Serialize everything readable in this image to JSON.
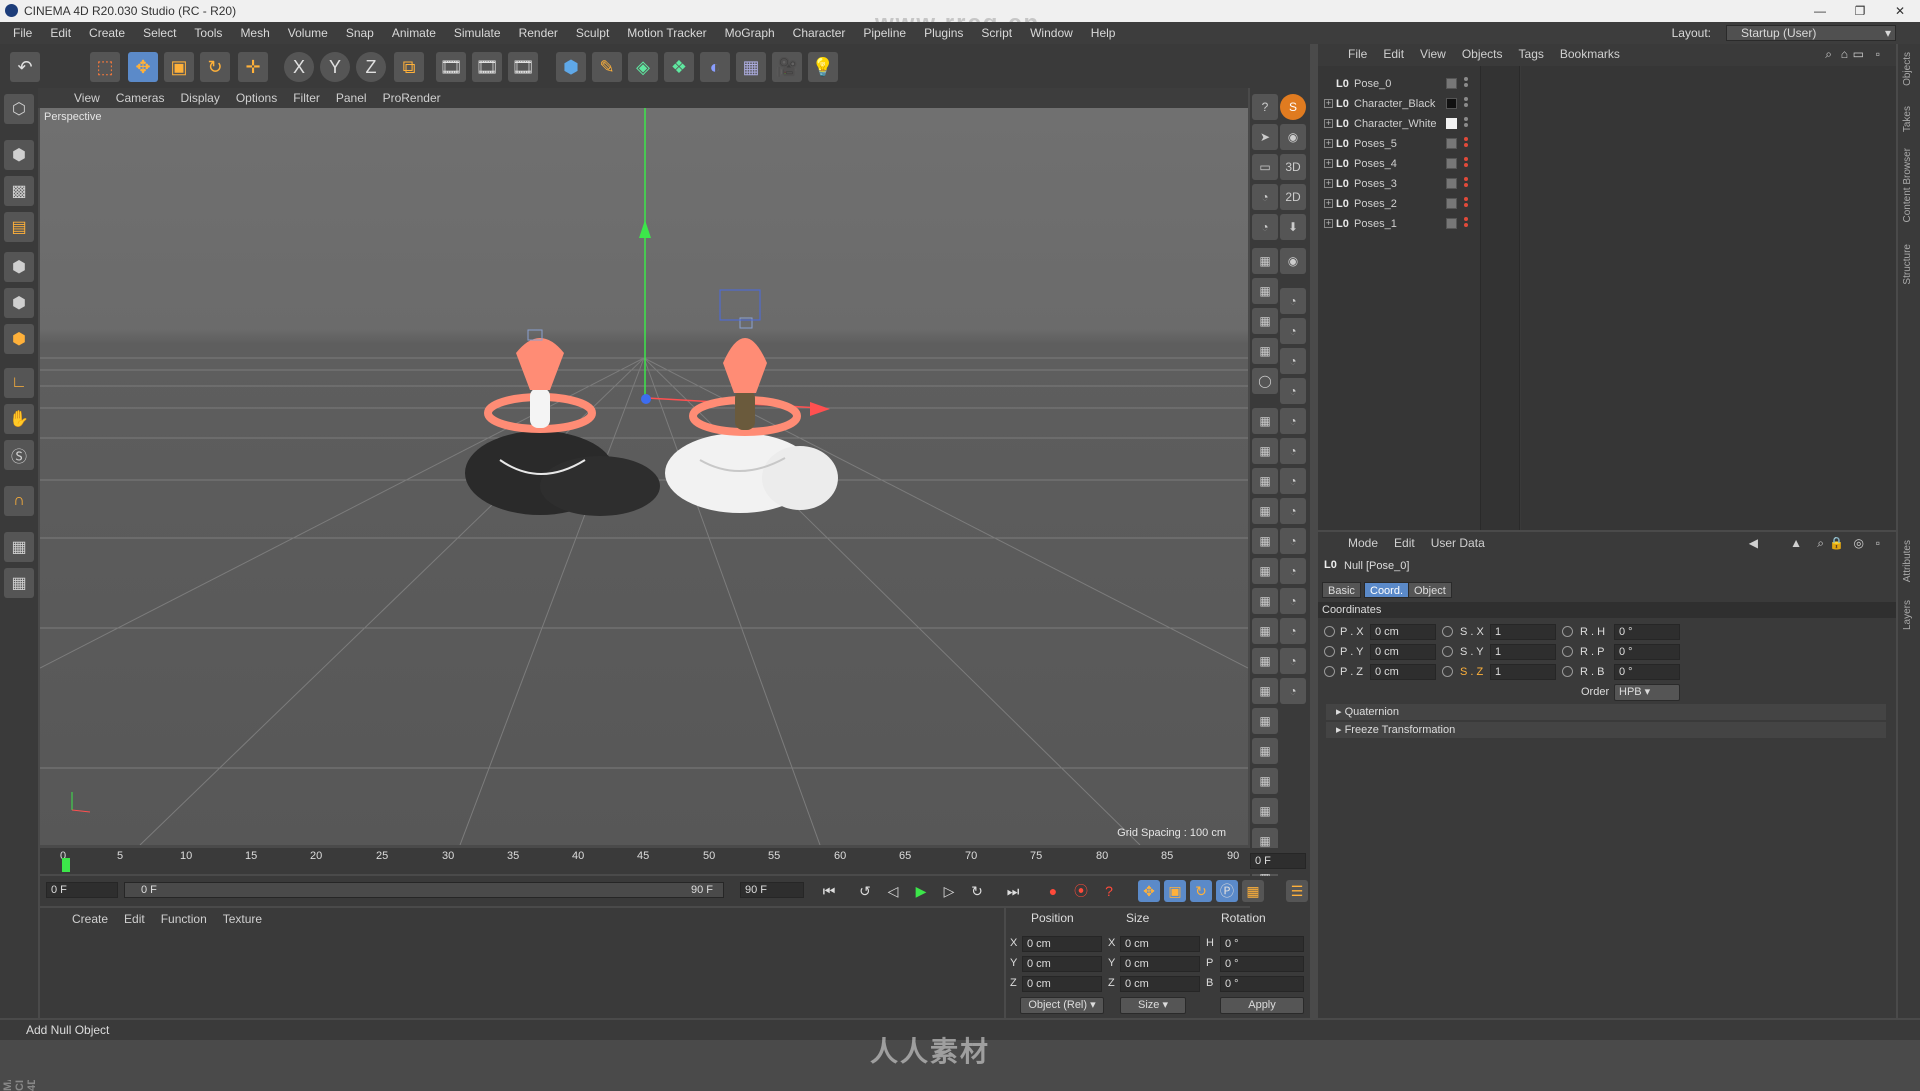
{
  "window": {
    "title": "CINEMA 4D R20.030 Studio (RC - R20)"
  },
  "menubar": {
    "items": [
      "File",
      "Edit",
      "Create",
      "Select",
      "Tools",
      "Mesh",
      "Volume",
      "Snap",
      "Animate",
      "Simulate",
      "Render",
      "Sculpt",
      "Motion Tracker",
      "MoGraph",
      "Character",
      "Pipeline",
      "Plugins",
      "Script",
      "Window",
      "Help"
    ],
    "layout_label": "Layout:",
    "layout_value": "Startup (User)"
  },
  "toolbar": {
    "icons": [
      "undo-icon",
      "live-selection-icon",
      "move-icon",
      "scale-icon",
      "rotate-icon",
      "last-tool-icon",
      "x-axis-icon",
      "y-axis-icon",
      "z-axis-icon",
      "coordinate-system-icon",
      "render-view-icon",
      "render-picture-viewer-icon",
      "render-settings-icon",
      "cube-icon",
      "pen-spline-icon",
      "subdivision-icon",
      "cloner-icon",
      "deformer-icon",
      "floor-icon",
      "camera-icon",
      "light-icon"
    ],
    "axis_labels": [
      "X",
      "Y",
      "Z"
    ]
  },
  "viewport": {
    "menu": [
      "View",
      "Cameras",
      "Display",
      "Options",
      "Filter",
      "Panel",
      "ProRender"
    ],
    "label": "Perspective",
    "grid_spacing": "Grid Spacing : 100 cm"
  },
  "timeline": {
    "ticks": [
      "0",
      "5",
      "10",
      "15",
      "20",
      "25",
      "30",
      "35",
      "40",
      "45",
      "50",
      "55",
      "60",
      "65",
      "70",
      "75",
      "80",
      "85",
      "90"
    ],
    "current_frame": "0 F"
  },
  "playback": {
    "start": "0 F",
    "range_start": "0 F",
    "range_end": "90 F",
    "end": "90 F"
  },
  "material_manager": {
    "menu": [
      "Create",
      "Edit",
      "Function",
      "Texture"
    ]
  },
  "coordinates_manager": {
    "headers": [
      "Position",
      "Size",
      "Rotation"
    ],
    "rows": [
      {
        "axis": "X",
        "pos": "0 cm",
        "size_axis": "X",
        "size": "0 cm",
        "rot_axis": "H",
        "rot": "0 °"
      },
      {
        "axis": "Y",
        "pos": "0 cm",
        "size_axis": "Y",
        "size": "0 cm",
        "rot_axis": "P",
        "rot": "0 °"
      },
      {
        "axis": "Z",
        "pos": "0 cm",
        "size_axis": "Z",
        "size": "0 cm",
        "rot_axis": "B",
        "rot": "0 °"
      }
    ],
    "mode_select": "Object (Rel)",
    "size_select": "Size",
    "apply": "Apply"
  },
  "status": {
    "text": "Add Null Object"
  },
  "object_manager": {
    "menu": [
      "File",
      "Edit",
      "View",
      "Objects",
      "Tags",
      "Bookmarks"
    ],
    "objects": [
      {
        "name": "Pose_0",
        "tag": "none"
      },
      {
        "name": "Character_Black",
        "tag": "#111111"
      },
      {
        "name": "Character_White",
        "tag": "#f2f2f2"
      },
      {
        "name": "Poses_5",
        "tag": "check"
      },
      {
        "name": "Poses_4",
        "tag": "check"
      },
      {
        "name": "Poses_3",
        "tag": "check"
      },
      {
        "name": "Poses_2",
        "tag": "check"
      },
      {
        "name": "Poses_1",
        "tag": "check"
      }
    ]
  },
  "attributes": {
    "menu": [
      "Mode",
      "Edit",
      "User Data"
    ],
    "object_title": "Null [Pose_0]",
    "tabs": [
      "Basic",
      "Coord.",
      "Object"
    ],
    "active_tab": "Coord.",
    "section": "Coordinates",
    "rows": [
      {
        "p_label": "P . X",
        "p": "0 cm",
        "s_label": "S . X",
        "s": "1",
        "r_label": "R . H",
        "r": "0 °"
      },
      {
        "p_label": "P . Y",
        "p": "0 cm",
        "s_label": "S . Y",
        "s": "1",
        "r_label": "R . P",
        "r": "0 °"
      },
      {
        "p_label": "P . Z",
        "p": "0 cm",
        "s_label": "S . Z",
        "s": "1",
        "r_label": "R . B",
        "r": "0 °"
      }
    ],
    "order_label": "Order",
    "order_value": "HPB",
    "collapsed_sections": [
      "Quaternion",
      "Freeze Transformation"
    ]
  },
  "side_tabs": [
    "Objects",
    "Takes",
    "Content Browser",
    "Structure",
    "Attributes",
    "Layers"
  ],
  "branding": {
    "maxon": "MAXON CINEMA 4D",
    "watermark": "人人素材",
    "watermark_top": "www.rrcg.cn"
  },
  "colors": {
    "accent": "#4a7fb5",
    "active_tab": "#5b8ac9",
    "panel_bg": "#3a3a3a"
  }
}
